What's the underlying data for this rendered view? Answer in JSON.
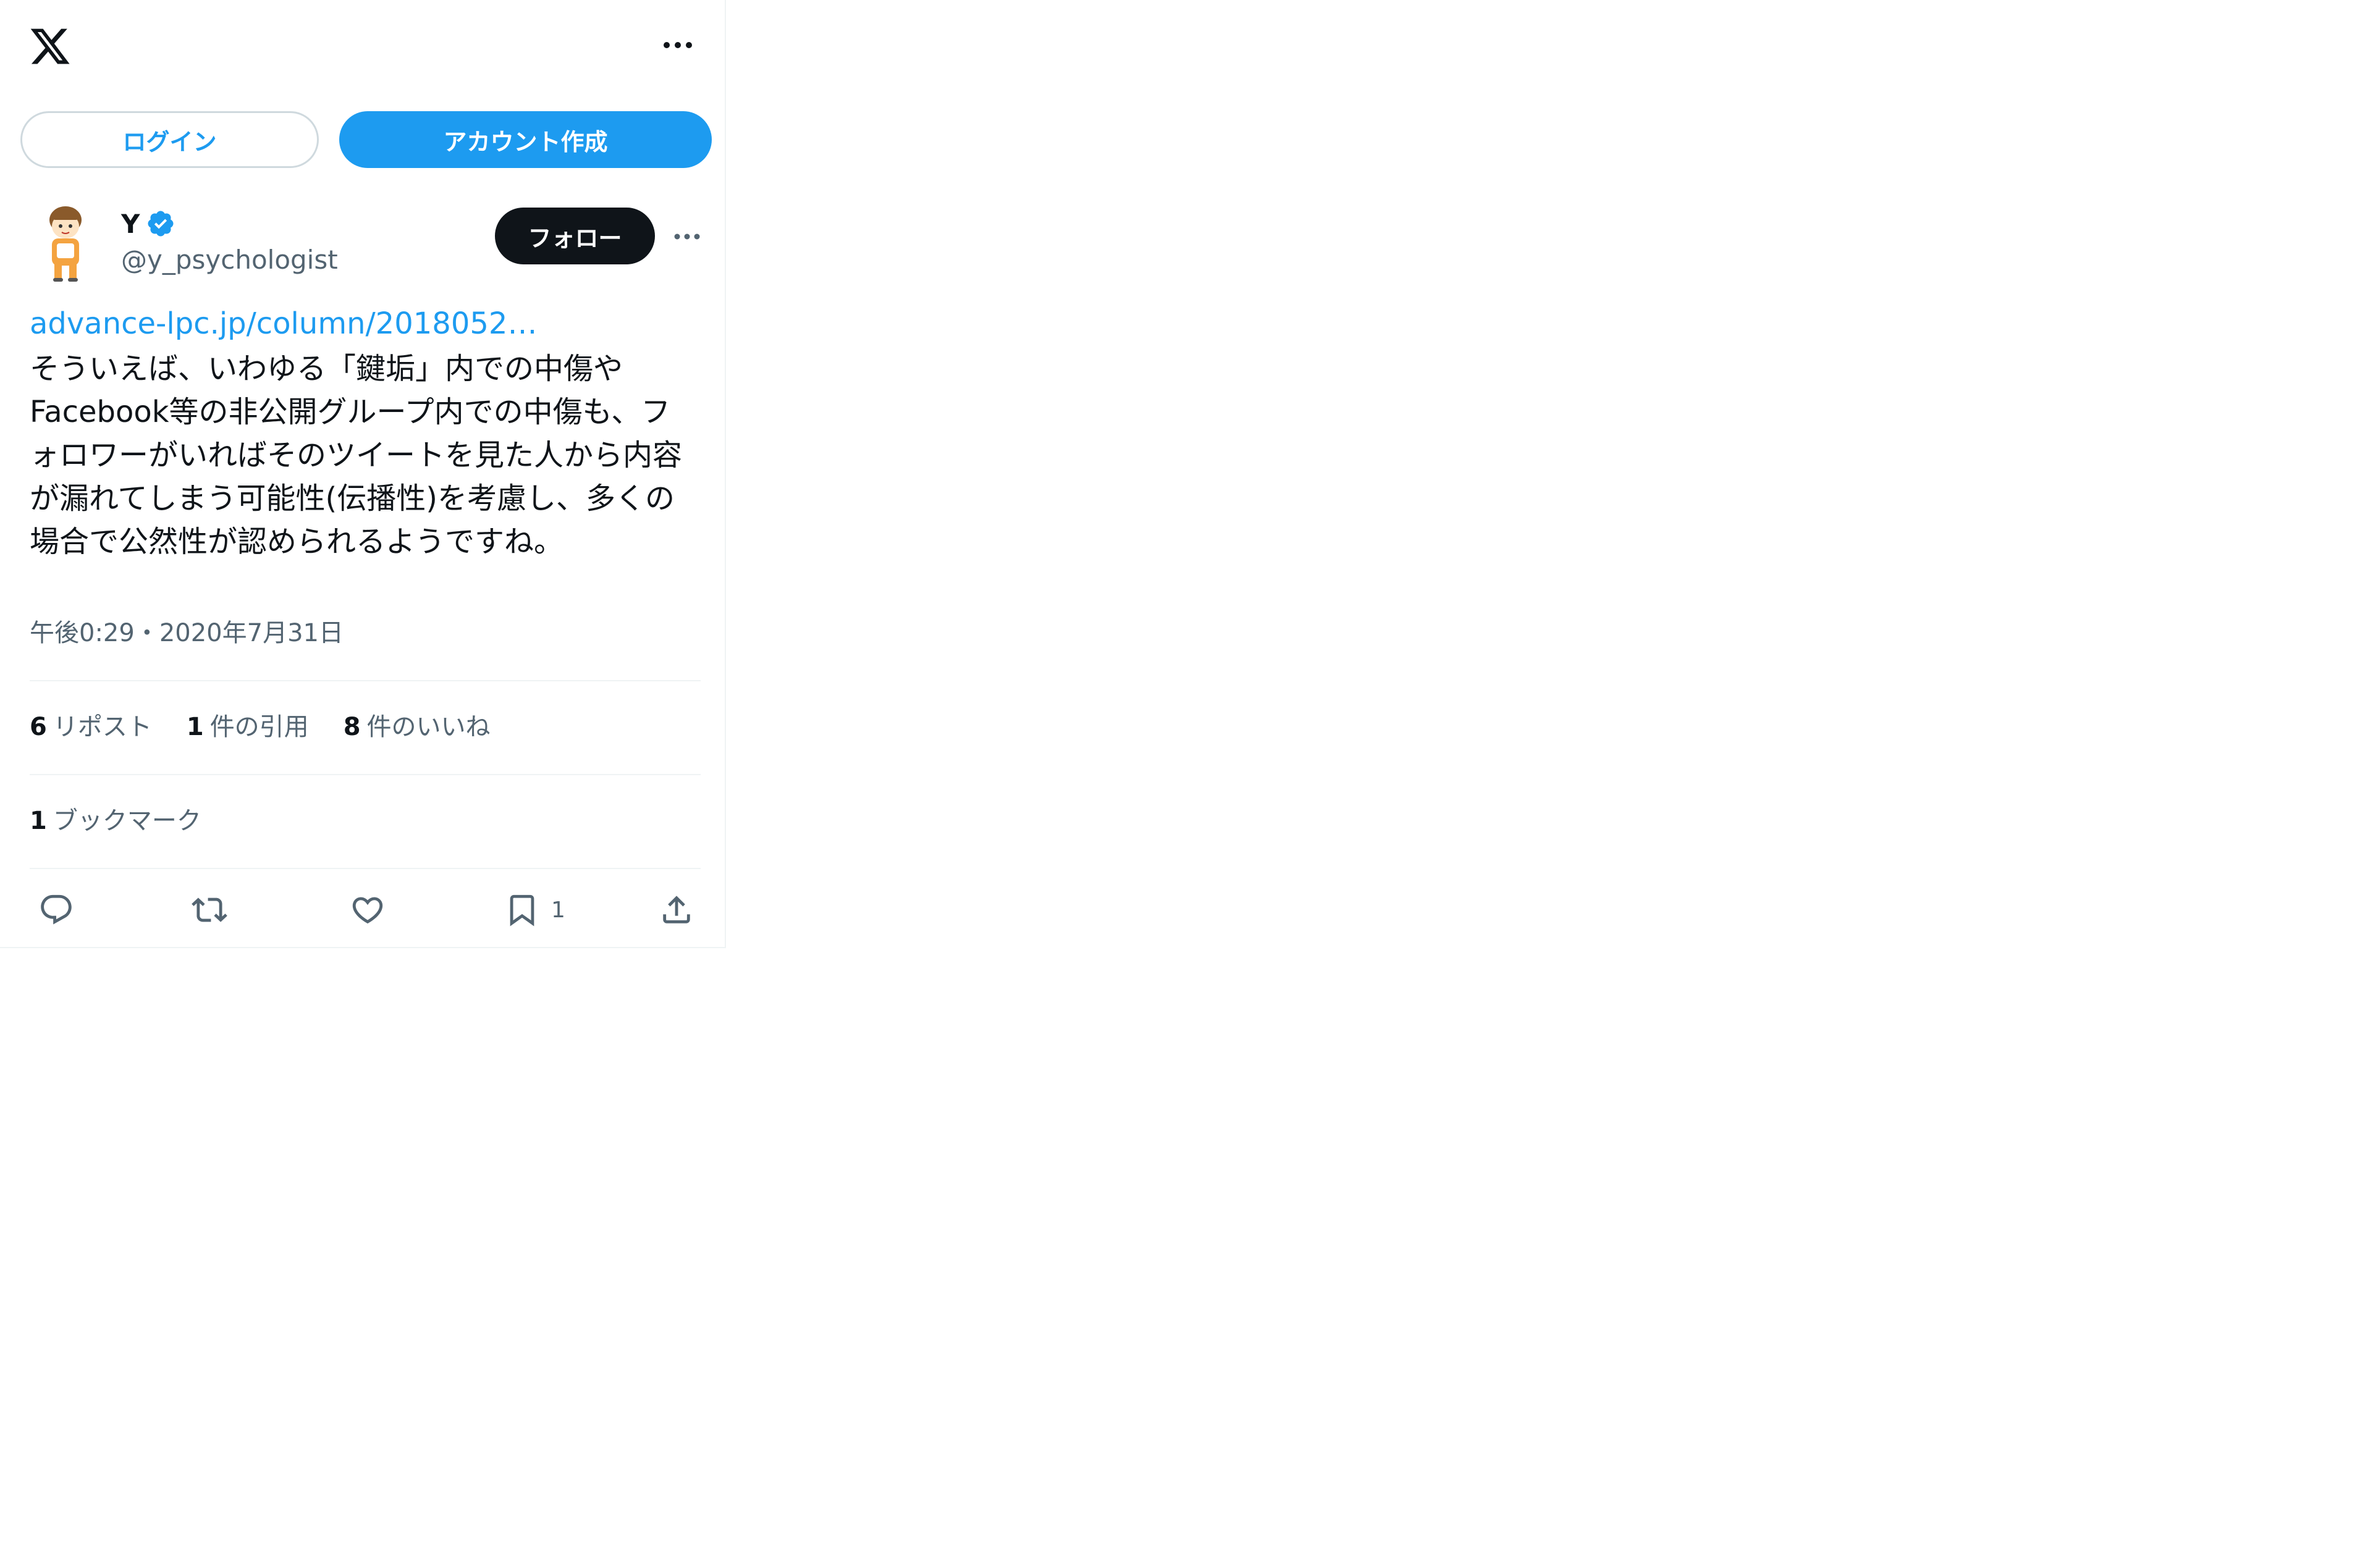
{
  "header": {
    "logo_icon": "x-logo-icon",
    "more_icon": "more-horizontal-icon"
  },
  "auth": {
    "login_label": "ログイン",
    "signup_label": "アカウント作成"
  },
  "author": {
    "display_name": "Y",
    "verified_icon": "verified-badge-icon",
    "handle": "@y_psychologist",
    "follow_label": "フォロー"
  },
  "tweet": {
    "link_text": "advance-lpc.jp/column/2018052…",
    "body": "そういえば、いわゆる「鍵垢」内での中傷や\nFacebook等の非公開グループ内での中傷も、フ\nォロワーがいればそのツイートを見た人から内容\nが漏れてしまう可能性(伝播性)を考慮し、多くの\n場合で公然性が認められるようですね。",
    "timestamp": "午後0:29・2020年7月31日"
  },
  "stats": {
    "reposts_count": "6",
    "reposts_label": "リポスト",
    "quotes_count": "1",
    "quotes_label": "件の引用",
    "likes_count": "8",
    "likes_label": "件のいいね",
    "bookmarks_count": "1",
    "bookmarks_label": "ブックマーク"
  },
  "actions": {
    "reply_icon": "reply-icon",
    "repost_icon": "repost-icon",
    "like_icon": "like-heart-icon",
    "bookmark_icon": "bookmark-icon",
    "bookmark_count": "1",
    "share_icon": "share-upload-icon"
  },
  "colors": {
    "accent": "#1d9bf0",
    "text": "#0f1419",
    "muted": "#536471",
    "border": "#cfd9de",
    "divider": "#eff3f4"
  }
}
